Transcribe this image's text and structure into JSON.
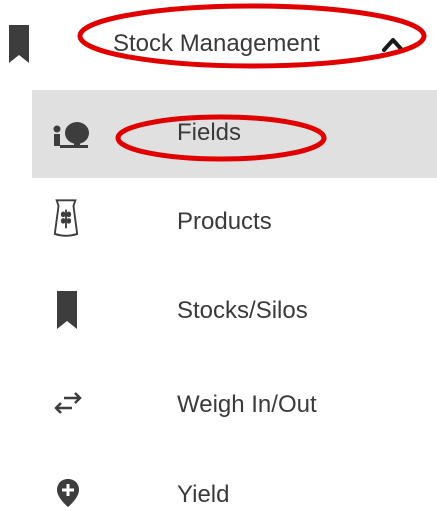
{
  "menu": {
    "header": {
      "label": "Stock Management",
      "expanded": true,
      "icon": "bookmark-icon",
      "chevron": "chevron-up-icon"
    },
    "items": [
      {
        "label": "Fields",
        "icon": "field-tree-icon",
        "selected": true
      },
      {
        "label": "Products",
        "icon": "seed-bag-icon",
        "selected": false
      },
      {
        "label": "Stocks/Silos",
        "icon": "bookmark-icon",
        "selected": false
      },
      {
        "label": "Weigh In/Out",
        "icon": "swap-arrows-icon",
        "selected": false
      },
      {
        "label": "Yield",
        "icon": "location-plus-icon",
        "selected": false
      }
    ]
  },
  "colors": {
    "annotation": "#e00000",
    "selected_background": "#e0e0e0",
    "icon": "#3d3d3d",
    "text": "#3a3a3a"
  }
}
